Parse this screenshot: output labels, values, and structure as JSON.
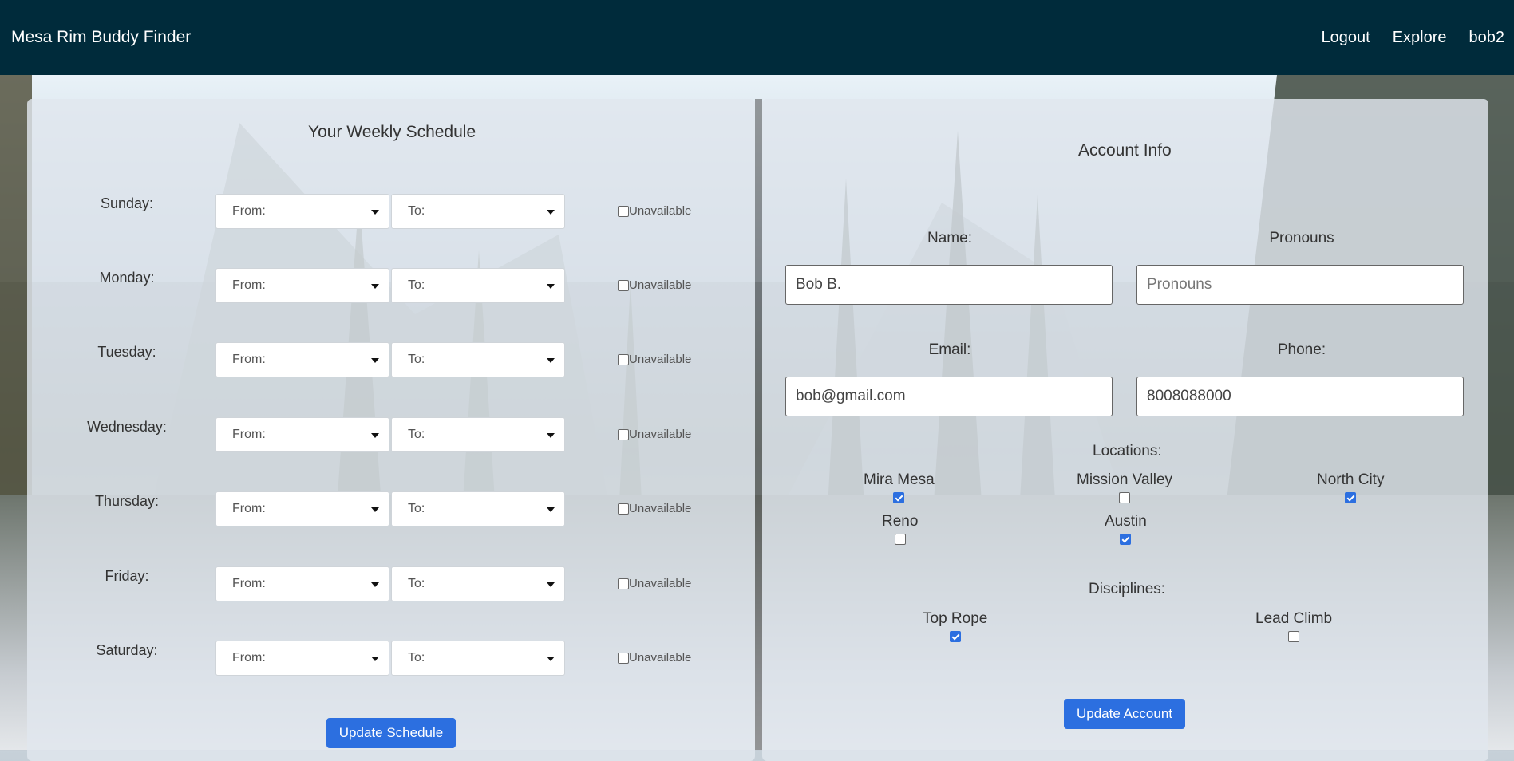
{
  "nav": {
    "brand": "Mesa Rim Buddy Finder",
    "links": [
      "Logout",
      "Explore",
      "bob2"
    ]
  },
  "schedule": {
    "title": "Your Weekly Schedule",
    "from_placeholder": "From:",
    "to_placeholder": "To:",
    "unavailable_label": "Unavailable",
    "days": [
      {
        "label": "Sunday:",
        "unavailable": false
      },
      {
        "label": "Monday:",
        "unavailable": false
      },
      {
        "label": "Tuesday:",
        "unavailable": false
      },
      {
        "label": "Wednesday:",
        "unavailable": false
      },
      {
        "label": "Thursday:",
        "unavailable": false
      },
      {
        "label": "Friday:",
        "unavailable": false
      },
      {
        "label": "Saturday:",
        "unavailable": false
      }
    ],
    "button": "Update Schedule"
  },
  "account": {
    "title": "Account Info",
    "name_label": "Name:",
    "name_value": "Bob B.",
    "pronouns_label": "Pronouns",
    "pronouns_placeholder": "Pronouns",
    "email_label": "Email:",
    "email_value": "bob@gmail.com",
    "phone_label": "Phone:",
    "phone_value": "8008088000",
    "locations_label": "Locations:",
    "locations": [
      {
        "name": "Mira Mesa",
        "checked": true
      },
      {
        "name": "Mission Valley",
        "checked": false
      },
      {
        "name": "North City",
        "checked": true
      },
      {
        "name": "Reno",
        "checked": false
      },
      {
        "name": "Austin",
        "checked": true
      }
    ],
    "disciplines_label": "Disciplines:",
    "disciplines": [
      {
        "name": "Top Rope",
        "checked": true
      },
      {
        "name": "Lead Climb",
        "checked": false
      }
    ],
    "button": "Update Account"
  },
  "colors": {
    "navbar": "#002b3b",
    "accent": "#2c6fe0"
  }
}
